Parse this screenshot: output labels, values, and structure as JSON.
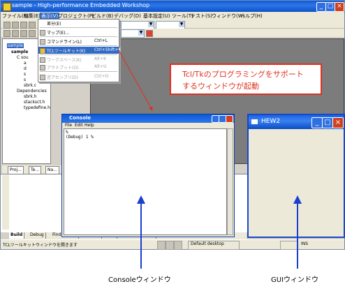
{
  "window": {
    "title": "sample - High-performance Embedded Workshop"
  },
  "menubar": {
    "items": [
      "ファイル(F)",
      "編集(E)",
      "表示(V)",
      "プロジェクト(P)",
      "ビルド(B)",
      "デバッグ(D)",
      "基本設定(U)",
      "ツール(T)",
      "テスト(S)",
      "ウィンドウ(W)",
      "ヘルプ(H)"
    ]
  },
  "dropdown": {
    "items": [
      {
        "label": "差分(E)",
        "key": ""
      },
      {
        "label": "マップ(E)...",
        "key": ""
      },
      {
        "label": "コマンドライン(L)",
        "key": "Ctrl+L"
      },
      {
        "label": "TCLツールキット(K)",
        "key": "Ctrl+Shift+K"
      },
      {
        "label": "ワークスペース(K)",
        "key": "Alt+K"
      },
      {
        "label": "アウトプット(O)",
        "key": "Alt+U"
      },
      {
        "label": "逆アセンブリ(D)",
        "key": "Ctrl+D"
      }
    ]
  },
  "workspace": {
    "root": "sample",
    "project": "sample",
    "folder_c": "C sou",
    "files": [
      "a",
      "d",
      "s",
      "s",
      "sbrk.c"
    ],
    "dependencies": "Dependencies",
    "dep_files": [
      "sbrk.h",
      "stacksct.h",
      "typedefine.h"
    ]
  },
  "ws_tabs": [
    "Proj...",
    "Te...",
    "Na..."
  ],
  "callout": {
    "line1": "Tcl/Tkのプログラミングをサポート",
    "line2": "するウィンドウが起動"
  },
  "console": {
    "title": "Console",
    "menu": [
      "File",
      "Edit",
      "Help"
    ],
    "line1": "%",
    "line2": "(Debug) 1 %"
  },
  "hew2": {
    "title": "HEW2"
  },
  "output_tabs": [
    "Build",
    "Debug",
    "Find in Files",
    "Macro",
    "Test",
    "Version Control"
  ],
  "statusbar": {
    "text": "TCLツールキットウィンドウを開きます",
    "desktop": "Default desktop",
    "mode": "INS"
  },
  "captions": {
    "console": "Consoleウィンドウ",
    "gui": "GUIウィンドウ"
  },
  "colors": {
    "accent": "#e0301e",
    "titlebar": "#0a5ad8"
  }
}
